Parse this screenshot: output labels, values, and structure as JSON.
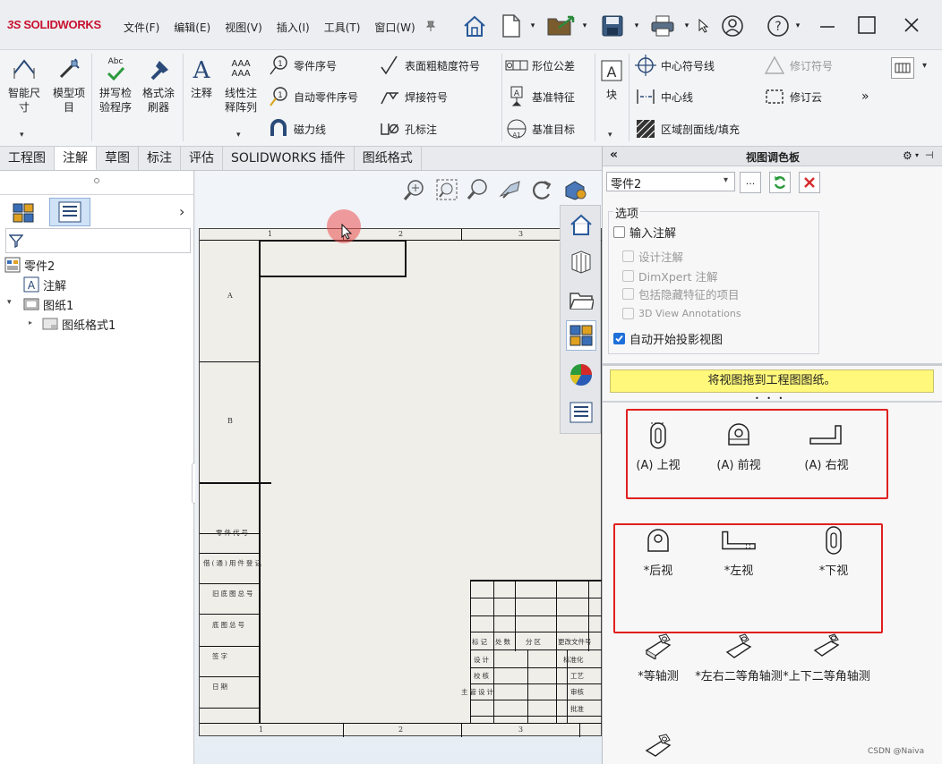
{
  "app": {
    "logo_ds": "3S",
    "logo_text": "SOLIDWORKS",
    "menus": [
      "文件(F)",
      "编辑(E)",
      "视图(V)",
      "插入(I)",
      "工具(T)",
      "窗口(W)"
    ]
  },
  "ribbon": {
    "smart_dim": "智能尺寸",
    "model_items": "模型项目",
    "spell_check": "拼写检验程序",
    "format_painter": "格式涂刷器",
    "note": "注释",
    "linear_pattern": "线性注释阵列",
    "aaa_label": "AAA",
    "abc_label": "Abc",
    "balloon": "零件序号",
    "auto_balloon": "自动零件序号",
    "magnetic_line": "磁力线",
    "surface_finish": "表面粗糙度符号",
    "weld_symbol": "焊接符号",
    "hole_callout": "孔标注",
    "geo_tol": "形位公差",
    "datum_feature": "基准特征",
    "datum_target": "基准目标",
    "block": "块",
    "center_mark": "中心符号线",
    "centerline": "中心线",
    "hatch": "区域剖面线/填充",
    "revision_symbol": "修订符号",
    "revision_cloud": "修订云",
    "more_chevron": "»"
  },
  "tabs": [
    "工程图",
    "注解",
    "草图",
    "标注",
    "评估",
    "SOLIDWORKS 插件",
    "图纸格式"
  ],
  "active_tab": 1,
  "tree": {
    "root": "零件2",
    "annotations": "注解",
    "sheet": "图纸1",
    "sheet_format": "图纸格式1",
    "collapse_arrow": "›"
  },
  "drawing": {
    "top_numbers": [
      "1",
      "2",
      "3"
    ],
    "bottom_numbers": [
      "1",
      "2",
      "3"
    ],
    "side_letters": [
      "A",
      "B"
    ],
    "left_block": [
      "零件代号",
      "借(通)用件登记",
      "旧底图总号",
      "底图总号",
      "签字",
      "日期"
    ],
    "title_block": {
      "header_row": [
        "标记",
        "处数",
        "分区",
        "更改文件号"
      ],
      "col_design": [
        "设计",
        "校核",
        "主管设计"
      ],
      "col_right": [
        "标准化",
        "工艺",
        "审核",
        "批准"
      ]
    }
  },
  "palette": {
    "title": "视图调色板",
    "collapse": "«",
    "pin": "⊣",
    "selected_doc": "零件2",
    "browse": "...",
    "options_title": "选项",
    "options": [
      {
        "label": "输入注解",
        "checked": false,
        "disabled": false
      },
      {
        "label": "设计注解",
        "checked": false,
        "disabled": true
      },
      {
        "label": "DimXpert 注解",
        "checked": false,
        "disabled": true
      },
      {
        "label": "包括隐藏特征的项目",
        "checked": false,
        "disabled": true
      },
      {
        "label": "3D View Annotations",
        "checked": false,
        "disabled": true
      },
      {
        "label": "自动开始投影视图",
        "checked": true,
        "disabled": false
      }
    ],
    "hint": "将视图拖到工程图图纸。",
    "views": [
      {
        "label": "(A) 上视",
        "icon": "top-view-icon"
      },
      {
        "label": "(A) 前视",
        "icon": "front-view-icon"
      },
      {
        "label": "(A) 右视",
        "icon": "right-view-icon"
      },
      {
        "label": "*后视",
        "icon": "back-view-icon"
      },
      {
        "label": "*左视",
        "icon": "left-view-icon"
      },
      {
        "label": "*下视",
        "icon": "bottom-view-icon"
      },
      {
        "label": "*等轴测",
        "icon": "isometric-icon"
      },
      {
        "label": "*左右二等角轴测",
        "icon": "dimetric-lr-icon"
      },
      {
        "label": "*上下二等角轴测",
        "icon": "dimetric-tb-icon"
      }
    ]
  },
  "watermark": "CSDN @Naiva"
}
